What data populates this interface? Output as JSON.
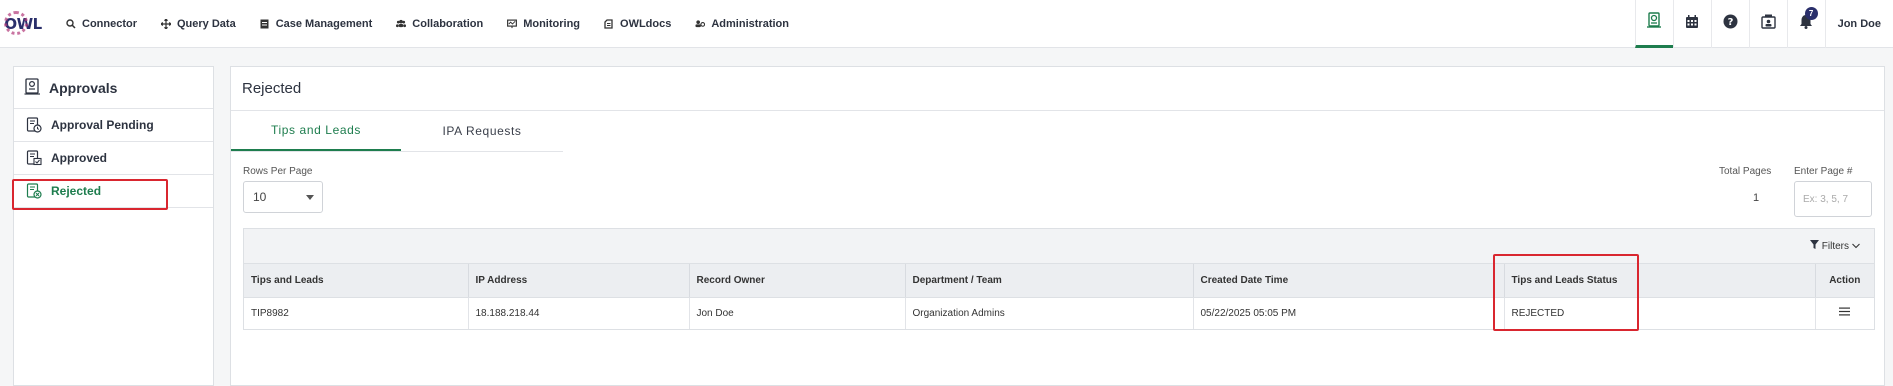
{
  "header": {
    "logo_text": "OWL",
    "nav": [
      {
        "label": "Connector",
        "icon": "search-icon"
      },
      {
        "label": "Query Data",
        "icon": "move-icon"
      },
      {
        "label": "Case Management",
        "icon": "briefcase-icon"
      },
      {
        "label": "Collaboration",
        "icon": "users-icon"
      },
      {
        "label": "Monitoring",
        "icon": "monitor-icon"
      },
      {
        "label": "OWLdocs",
        "icon": "document-icon"
      },
      {
        "label": "Administration",
        "icon": "admin-icon"
      }
    ],
    "notification_count": "7",
    "user_name": "Jon Doe"
  },
  "sidebar": {
    "title": "Approvals",
    "items": [
      {
        "label": "Approval Pending",
        "icon": "clock-document-icon"
      },
      {
        "label": "Approved",
        "icon": "check-document-icon"
      },
      {
        "label": "Rejected",
        "icon": "rejected-document-icon"
      }
    ]
  },
  "main": {
    "title": "Rejected",
    "tabs": [
      "Tips and Leads",
      "IPA Requests"
    ],
    "rows_per_page_label": "Rows Per Page",
    "rows_per_page_value": "10",
    "total_pages_label": "Total Pages",
    "total_pages_value": "1",
    "enter_page_label": "Enter Page #",
    "enter_page_placeholder": "Ex: 3, 5, 7",
    "filters_label": "Filters",
    "columns": [
      "Tips and Leads",
      "IP Address",
      "Record Owner",
      "Department / Team",
      "Created Date Time",
      "Tips and Leads Status",
      "Action"
    ],
    "rows": [
      [
        "TIP8982",
        "18.188.218.44",
        "Jon Doe",
        "Organization Admins",
        "05/22/2025 05:05 PM",
        "REJECTED"
      ]
    ]
  },
  "colors": {
    "accent": "#1e7d4e",
    "highlight": "#d9262f",
    "brand": "#2a2f6b"
  }
}
